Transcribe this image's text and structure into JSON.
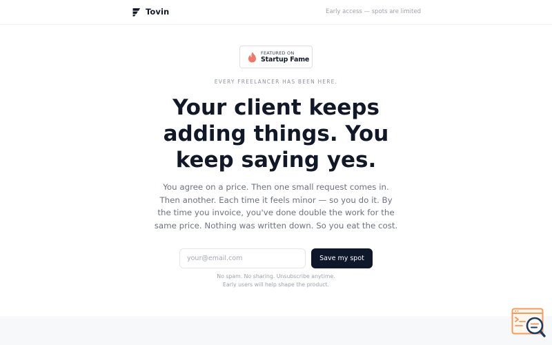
{
  "header": {
    "brand_name": "Tovin",
    "note": "Early access — spots are limited"
  },
  "badge": {
    "small": "FEATURED ON",
    "big": "Startup Fame"
  },
  "hero": {
    "eyebrow": "EVERY FREELANCER HAS BEEN HERE.",
    "headline": "Your client keeps adding things. You keep saying yes.",
    "body": "You agree on a price. Then one small request comes in. Then another. Each time it feels minor — so you do it. By the time you invoice, you've done double the work for the same price. Nothing was written down. So you eat the cost."
  },
  "signup": {
    "email_placeholder": "your@email.com",
    "email_value": "",
    "button_label": "Save my spot",
    "fine_print_1": "No spam. No sharing. Unsubscribe anytime.",
    "fine_print_2": "Early users will help shape the product."
  },
  "icons": {
    "brand": "tovin-logo-icon",
    "badge": "flame-icon",
    "widget": "search-code-icon"
  },
  "colors": {
    "text": "#111827",
    "muted": "#6b7280",
    "button_bg": "#0f172a",
    "flame": "#f0776a",
    "widget_orange": "#f39a5c",
    "widget_navy": "#1e3a5f"
  }
}
